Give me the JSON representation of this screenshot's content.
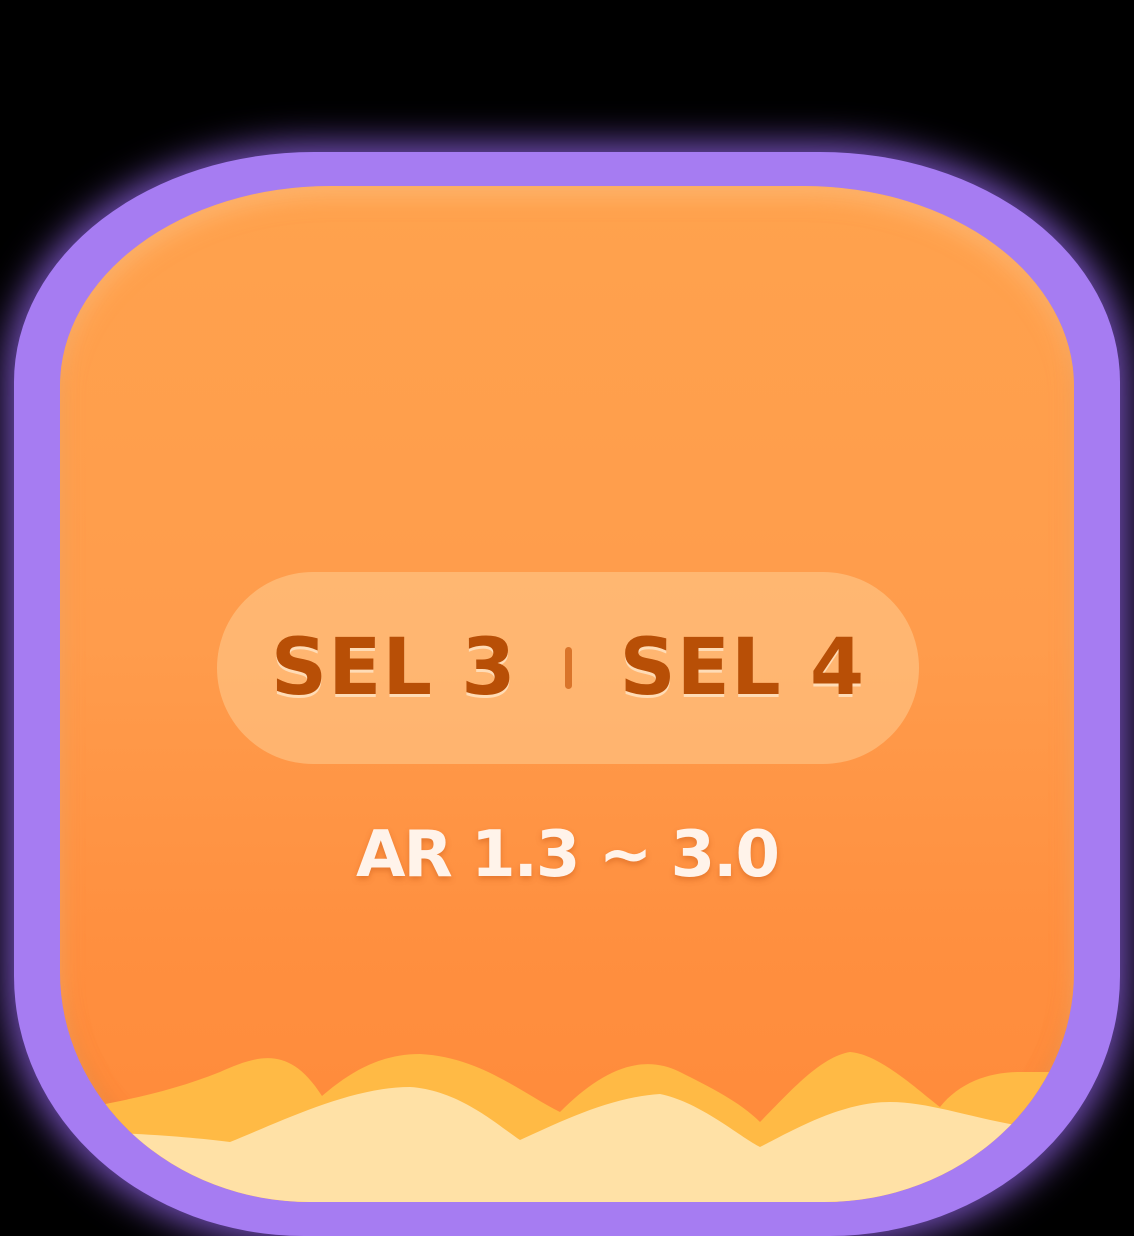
{
  "badge": {
    "left_label": "SEL 3",
    "right_label": "SEL 4",
    "range_text": "AR 1.3 ~ 3.0"
  },
  "colors": {
    "outer_glow": "#a67cf2",
    "card_orange": "#ff9c4c",
    "pill_text": "#b84f06",
    "wave_yellow": "#ffc04a",
    "wave_cream": "#ffe1a6"
  }
}
